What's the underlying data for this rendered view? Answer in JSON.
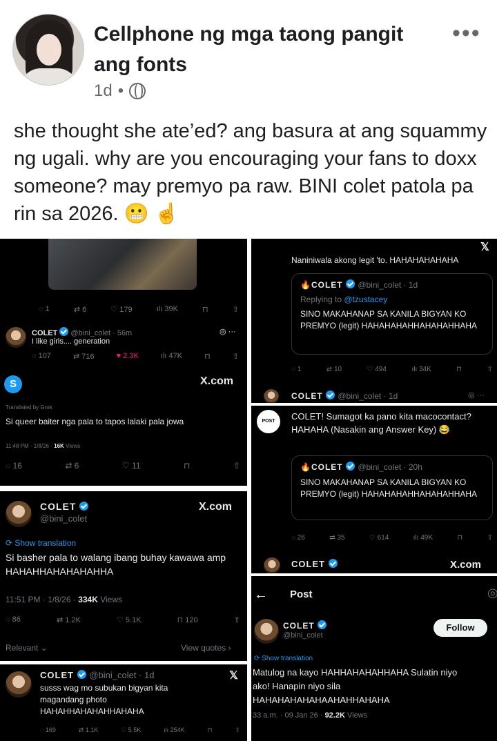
{
  "post": {
    "author": "Cellphone ng mga taong pangit ang fonts",
    "time": "1d",
    "separator": "•",
    "caption": "she thought she ate’ed? ang basura at ang squammy ng ugali. why are you encouraging your fans to doxx someone? may premyo pa raw. BINI colet patola pa rin sa 2026. 😬 ☝️"
  },
  "panel_a": {
    "stats_top": {
      "replies": "1",
      "reposts": "6",
      "likes": "179",
      "views": "39K"
    },
    "reply_name": "COLET",
    "reply_handle": "@bini_colet · 56m",
    "reply_text": "I like girls.... generation",
    "reply_stats": {
      "replies": "107",
      "reposts": "716",
      "likes": "2.3K",
      "views": "47K"
    },
    "x_com": "X.com",
    "avatar_letter": "S",
    "translated": "Translated by Grok",
    "body": "Si queer baiter nga pala to tapos lalaki pala jowa",
    "meta_time": "11:48 PM · 1/8/26 ·",
    "meta_views": "16K",
    "meta_views_label": "Views",
    "bottom_stats": {
      "replies": "16",
      "reposts": "6",
      "likes": "11"
    }
  },
  "panel_b": {
    "name": "COLET",
    "handle": "@bini_colet",
    "x_com": "X.com",
    "show_translation": "Show translation",
    "body": "Si basher pala to walang ibang buhay kawawa amp HAHAHHAHAHAHAHHA",
    "meta_time": "11:51 PM · 1/8/26 ·",
    "meta_views": "334K",
    "meta_views_label": "Views",
    "stats": {
      "replies": "86",
      "reposts": "1.2K",
      "likes": "5.1K",
      "bookmarks": "120"
    },
    "relevant": "Relevant",
    "view_quotes": "View quotes"
  },
  "panel_c": {
    "name": "COLET",
    "handle": "@bini_colet · 1d",
    "body": "susss wag mo subukan bigyan kita magandang photo HAHAHHAHAHAHHAHAHA",
    "stats": {
      "replies": "169",
      "reposts": "1.1K",
      "likes": "5.5K",
      "views": "254K"
    }
  },
  "panel_d": {
    "top_text": "Naniniwala akong legit 'to. HAHAHAHAHAHA",
    "quote_name": "COLET",
    "quote_handle": "@bini_colet · 1d",
    "replying_to_label": "Replying to",
    "replying_to_handle": "@tzustacey",
    "quote_body": "SINO MAKAHANAP SA KANILA BIGYAN KO PREMYO (legit) HAHAHAHAHHAHAHAHHAHA",
    "stats": {
      "replies": "1",
      "reposts": "10",
      "likes": "494",
      "views": "34K"
    },
    "bottom_name": "COLET",
    "bottom_handle": "@bini_colet · 1d"
  },
  "panel_e": {
    "avatar_text": "POST",
    "body": "COLET! Sumagot ka pano kita macocontact? HAHAHA (Nasakin ang Answer Key) 😂",
    "quote_name": "COLET",
    "quote_handle": "@bini_colet · 20h",
    "quote_body": "SINO MAKAHANAP SA KANILA BIGYAN KO PREMYO (legit) HAHAHAHAHHAHAHAHHAHA",
    "stats": {
      "replies": "26",
      "reposts": "35",
      "likes": "614",
      "views": "49K"
    },
    "bottom_name": "COLET",
    "x_com": "X.com"
  },
  "panel_f": {
    "back": "←",
    "title": "Post",
    "name": "COLET",
    "handle": "@bini_colet",
    "follow": "Follow",
    "show_translation": "Show translation",
    "body": "Matulog na kayo HAHHAHAHAHHAHA Sulatin niyo ako! Hanapin niyo sila HAHAHAHAHAHAAHAHHAHAHA",
    "meta_time": "33 a.m. · 09 Jan 26 ·",
    "meta_views": "92.2K",
    "meta_views_label": "Views"
  },
  "colors": {
    "x_blue": "#1d9bf0",
    "x_bg": "#000000",
    "x_text": "#e7e9ea",
    "x_muted": "#71767b",
    "like_pink": "#f91880"
  }
}
